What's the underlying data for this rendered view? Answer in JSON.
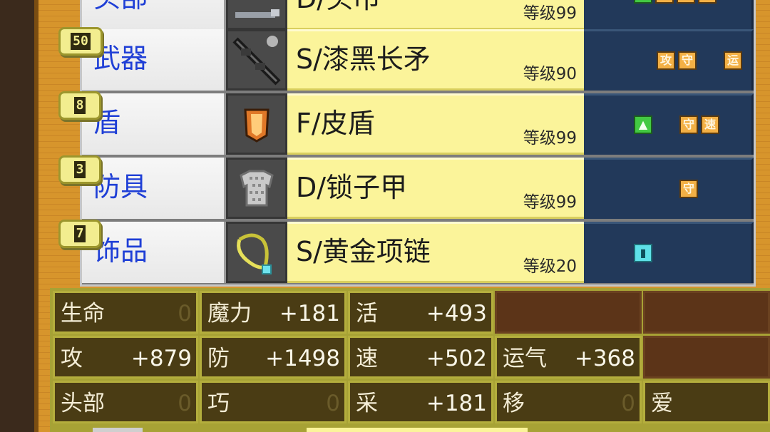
{
  "equipment": [
    {
      "slot": "头部",
      "item": "D/头巾",
      "level": "等级99",
      "icon": "headband-icon",
      "badge": null,
      "skills": [
        {
          "color": "green",
          "glyph": "▲"
        },
        {
          "color": "orange",
          "glyph": "攻"
        },
        {
          "color": "orange",
          "glyph": "守"
        },
        {
          "color": "orange",
          "glyph": "防"
        }
      ]
    },
    {
      "slot": "武器",
      "item": "S/漆黑长矛",
      "level": "等级90",
      "icon": "spear-icon",
      "badge": "50",
      "skills": [
        {
          "color": "orange",
          "glyph": "攻"
        },
        {
          "color": "orange",
          "glyph": "守"
        },
        {
          "color": "orange",
          "glyph": "运"
        }
      ]
    },
    {
      "slot": "盾",
      "item": "F/皮盾",
      "level": "等级99",
      "icon": "leather-shield-icon",
      "badge": "8",
      "skills": [
        {
          "color": "green",
          "glyph": "▲"
        },
        {
          "color": "orange",
          "glyph": "守"
        },
        {
          "color": "orange",
          "glyph": "速"
        }
      ]
    },
    {
      "slot": "防具",
      "item": "D/锁子甲",
      "level": "等级99",
      "icon": "chainmail-icon",
      "badge": "3",
      "skills": [
        {
          "color": "orange",
          "glyph": "守"
        }
      ]
    },
    {
      "slot": "饰品",
      "item": "S/黄金项链",
      "level": "等级20",
      "icon": "gold-necklace-icon",
      "badge": "7",
      "skills": [
        {
          "color": "cyan",
          "glyph": "▮"
        }
      ]
    }
  ],
  "stats": {
    "row1": [
      {
        "k": "生命",
        "v": "0"
      },
      {
        "k": "魔力",
        "v": "+181"
      },
      {
        "k": "活",
        "v": "+493"
      }
    ],
    "row2": [
      {
        "k": "攻",
        "v": "+879"
      },
      {
        "k": "防",
        "v": "+1498"
      },
      {
        "k": "速",
        "v": "+502"
      },
      {
        "k": "运气",
        "v": "+368"
      }
    ],
    "row3": [
      {
        "k": "头部",
        "v": "0"
      },
      {
        "k": "巧",
        "v": "0"
      },
      {
        "k": "采",
        "v": "+181"
      },
      {
        "k": "移",
        "v": "0"
      },
      {
        "k": "爱",
        "v": ""
      }
    ]
  },
  "colors": {
    "label_text": "#1f3fd6",
    "name_bg": "#fbf49a",
    "skill_bg": "#22395a",
    "stat_bg": "#4a3c14",
    "frame_wood": "#d7952c"
  }
}
